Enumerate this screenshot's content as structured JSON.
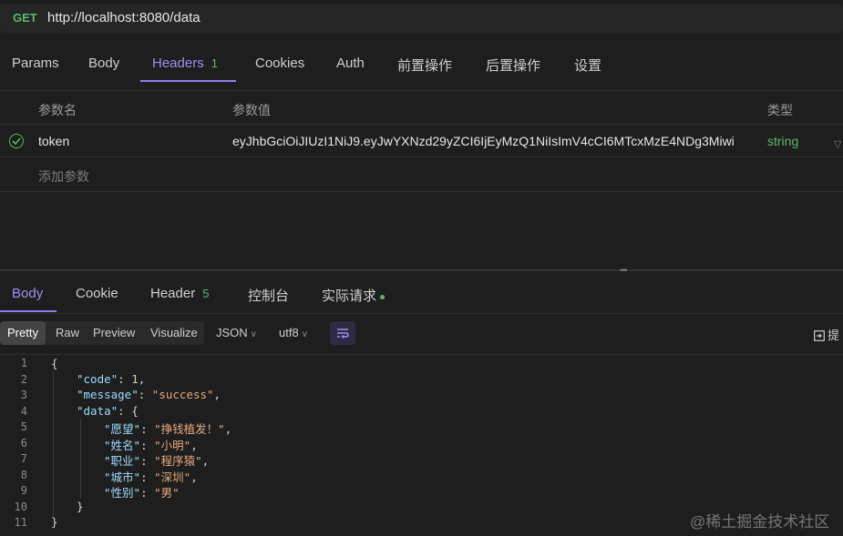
{
  "request": {
    "method": "GET",
    "url": "http://localhost:8080/data",
    "tabs": [
      "Params",
      "Body",
      "Headers",
      "Cookies",
      "Auth",
      "前置操作",
      "后置操作",
      "设置"
    ],
    "headers_count": "1"
  },
  "headers_table": {
    "col_name": "参数名",
    "col_value": "参数值",
    "col_type": "类型",
    "row": {
      "name": "token",
      "value": "eyJhbGciOiJIUzI1NiJ9.eyJwYXNzd29yZCI6IjEyMzQ1NiIsImV4cCI6MTcxMzE4NDg3Miwi",
      "type": "string"
    },
    "add_placeholder": "添加参数"
  },
  "response": {
    "tabs": [
      "Body",
      "Cookie",
      "Header",
      "控制台",
      "实际请求"
    ],
    "header_count": "5",
    "view_modes": [
      "Pretty",
      "Raw",
      "Preview",
      "Visualize"
    ],
    "format": "JSON",
    "encoding": "utf8",
    "extract_label": "提"
  },
  "code": {
    "line_numbers": [
      "1",
      "2",
      "3",
      "4",
      "5",
      "6",
      "7",
      "8",
      "9",
      "10",
      "11"
    ],
    "line1": "{",
    "code_key": "\"code\"",
    "code_val": "1",
    "message_key": "\"message\"",
    "message_val": "\"success\"",
    "data_key": "\"data\"",
    "wish_key": "\"愿望\"",
    "wish_val": "\"挣钱植发！\"",
    "name_key": "\"姓名\"",
    "name_val": "\"小明\"",
    "job_key": "\"职业\"",
    "job_val": "\"程序猿\"",
    "city_key": "\"城市\"",
    "city_val": "\"深圳\"",
    "gender_key": "\"性别\"",
    "gender_val": "\"男\"",
    "close_inner": "}",
    "close_outer": "}"
  },
  "watermark": "@稀土掘金技术社区"
}
